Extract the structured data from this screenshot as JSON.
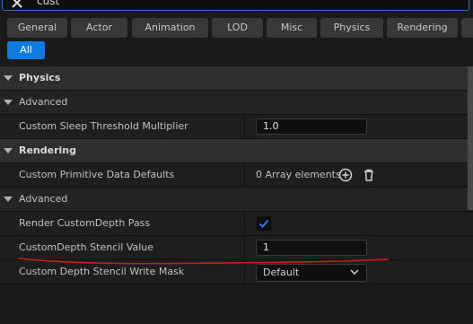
{
  "search": {
    "value": "cust"
  },
  "filters": {
    "tabs": [
      "General",
      "Actor",
      "Animation",
      "LOD",
      "Misc",
      "Physics",
      "Rendering"
    ],
    "all_label": "All"
  },
  "panel": {
    "physics_header": "Physics",
    "physics_advanced": "Advanced",
    "sleep_label": "Custom Sleep Threshold Multiplier",
    "sleep_value": "1.0",
    "rendering_header": "Rendering",
    "primitive_label": "Custom Primitive Data Defaults",
    "primitive_value": "0 Array elements",
    "rendering_advanced": "Advanced",
    "render_pass_label": "Render CustomDepth Pass",
    "render_pass_checked": true,
    "stencil_label": "CustomDepth Stencil Value",
    "stencil_value": "1",
    "mask_label": "Custom Depth Stencil Write Mask",
    "mask_value": "Default"
  },
  "colors": {
    "accent": "#0e7be0",
    "annotation": "#d41b1b"
  }
}
